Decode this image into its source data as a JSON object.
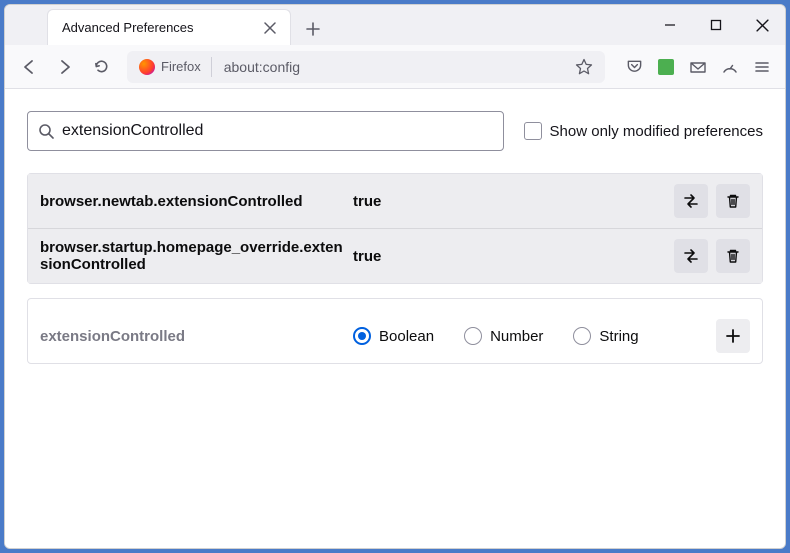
{
  "window": {
    "tab_title": "Advanced Preferences"
  },
  "nav": {
    "identity_label": "Firefox",
    "url": "about:config"
  },
  "search": {
    "value": "extensionControlled",
    "checkbox_label": "Show only modified preferences"
  },
  "prefs": [
    {
      "name": "browser.newtab.extensionControlled",
      "value": "true"
    },
    {
      "name": "browser.startup.homepage_override.extensionControlled",
      "value": "true"
    }
  ],
  "new_pref": {
    "name": "extensionControlled",
    "types": {
      "boolean": "Boolean",
      "number": "Number",
      "string": "String"
    }
  }
}
